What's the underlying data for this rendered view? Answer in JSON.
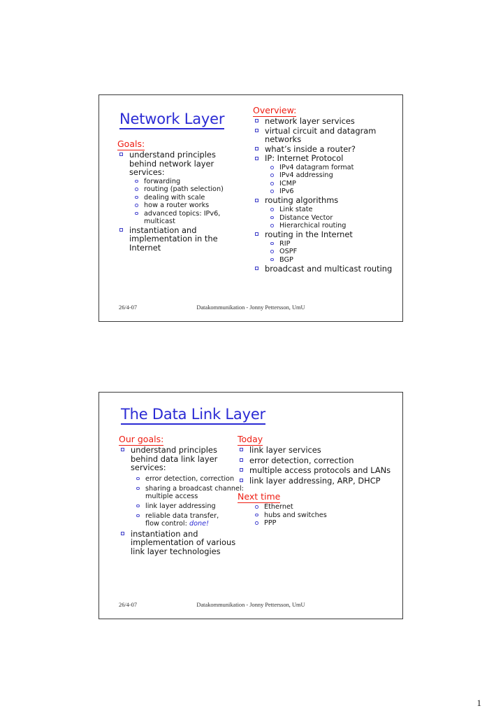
{
  "page": {
    "page_number": "1"
  },
  "slides": [
    {
      "title": "Network Layer",
      "footer": {
        "date": "26/4-07",
        "center": "Datakommunikation - Jonny Pettersson, UmU"
      },
      "left": {
        "heading": "Goals:",
        "items": [
          {
            "text": "understand principles behind network layer services:",
            "sub": [
              "forwarding",
              "routing (path selection)",
              "dealing with scale",
              "how a router works",
              "advanced topics: IPv6, multicast"
            ]
          },
          {
            "text": "instantiation and implementation in the Internet",
            "sub": []
          }
        ]
      },
      "right": {
        "heading": "Overview:",
        "items": [
          {
            "text": "network layer services",
            "sub": []
          },
          {
            "text": "virtual circuit and datagram networks",
            "sub": []
          },
          {
            "text": "what’s inside a router?",
            "sub": []
          },
          {
            "text": "IP: Internet Protocol",
            "sub": [
              "IPv4 datagram format",
              "IPv4 addressing",
              "ICMP",
              "IPv6"
            ]
          },
          {
            "text": "routing algorithms",
            "sub": [
              "Link state",
              "Distance Vector",
              "Hierarchical routing"
            ]
          },
          {
            "text": "routing in the Internet",
            "sub": [
              "RIP",
              "OSPF",
              "BGP"
            ]
          },
          {
            "text": "broadcast and multicast routing",
            "sub": []
          }
        ]
      }
    },
    {
      "title": "The Data Link Layer",
      "footer": {
        "date": "26/4-07",
        "center": "Datakommunikation - Jonny Pettersson, UmU"
      },
      "left": {
        "heading": "Our goals:",
        "items": [
          {
            "text": "understand principles behind data link layer services:",
            "sub": [
              "error detection, correction",
              "sharing a broadcast channel: multiple access",
              "link layer addressing",
              "reliable data transfer, flow control: done!"
            ]
          },
          {
            "text": "instantiation and implementation of various link layer technologies",
            "sub": []
          }
        ]
      },
      "right": {
        "heading": "Today",
        "items": [
          {
            "text": "link layer services",
            "sub": []
          },
          {
            "text": "error detection, correction",
            "sub": []
          },
          {
            "text": "multiple access protocols and LANs",
            "sub": []
          },
          {
            "text": "link layer addressing, ARP, DHCP",
            "sub": []
          }
        ],
        "heading2": "Next time",
        "items2_sub": [
          "Ethernet",
          "hubs and switches",
          "PPP"
        ]
      }
    }
  ],
  "emphasis": {
    "done_word": "done!"
  },
  "colors": {
    "title_blue": "#2b2bd4",
    "heading_red": "#ee1c11",
    "bullet_blue": "#3b3bc8",
    "body_black": "#141414"
  }
}
